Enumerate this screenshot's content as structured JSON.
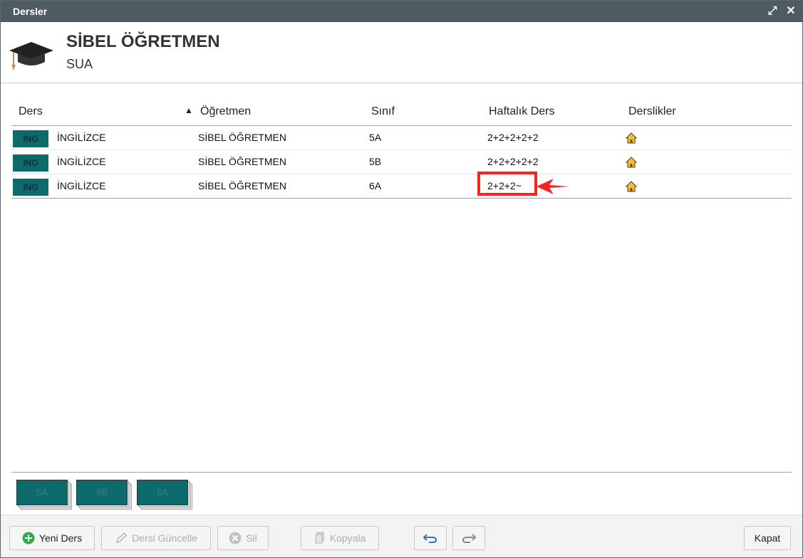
{
  "window": {
    "title": "Dersler"
  },
  "header": {
    "teacher_name": "SİBEL ÖĞRETMEN",
    "school_code": "SUA",
    "icon": "graduation-cap-icon"
  },
  "table": {
    "columns": [
      "Ders",
      "Öğretmen",
      "Sınıf",
      "Haftalık Ders",
      "Derslikler"
    ],
    "sort_indicator": "▲",
    "rows": [
      {
        "badge": "İNG",
        "course": "İNGİLİZCE",
        "teacher": "SİBEL ÖĞRETMEN",
        "class": "5A",
        "weekly": "2+2+2+2+2"
      },
      {
        "badge": "İNG",
        "course": "İNGİLİZCE",
        "teacher": "SİBEL ÖĞRETMEN",
        "class": "5B",
        "weekly": "2+2+2+2+2"
      },
      {
        "badge": "İNG",
        "course": "İNGİLİZCE",
        "teacher": "SİBEL ÖĞRETMEN",
        "class": "6A",
        "weekly": "2+2+2~"
      }
    ]
  },
  "class_tiles": [
    "5A",
    "5B",
    "6A"
  ],
  "footer": {
    "new_label": "Yeni Ders",
    "update_label": "Dersi Güncelle",
    "delete_label": "Sil",
    "copy_label": "Kopyala",
    "close_label": "Kapat"
  },
  "colors": {
    "titlebar": "#4f5b63",
    "badge": "#0e6b6b",
    "highlight": "#ff2020"
  }
}
